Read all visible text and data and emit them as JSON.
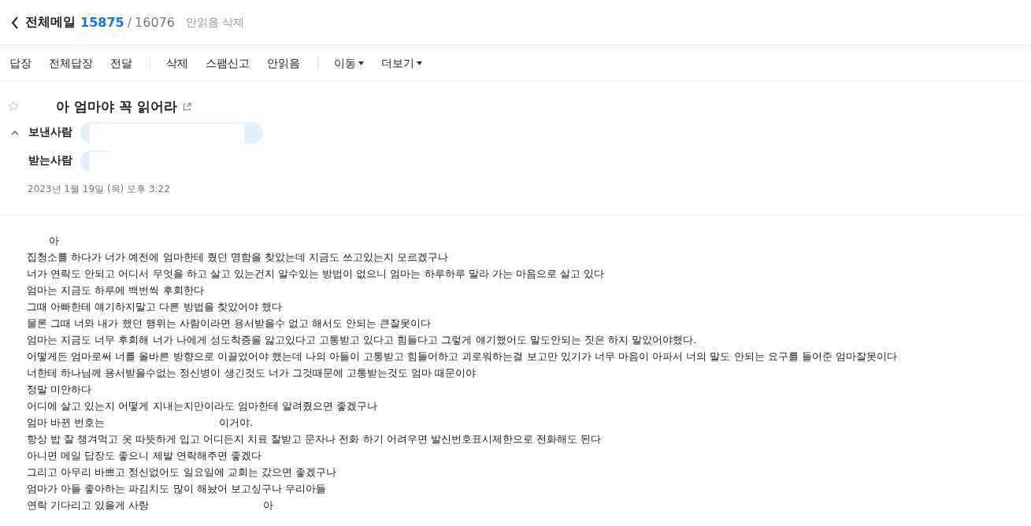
{
  "header": {
    "folder": "전체메일",
    "unread_count": "15875",
    "separator": "/",
    "total_count": "16076",
    "action": "안읽음 삭제"
  },
  "toolbar": {
    "groups": [
      [
        {
          "label": "답장",
          "dropdown": false
        },
        {
          "label": "전체답장",
          "dropdown": false
        },
        {
          "label": "전달",
          "dropdown": false
        }
      ],
      [
        {
          "label": "삭제",
          "dropdown": false
        },
        {
          "label": "스팸신고",
          "dropdown": false
        },
        {
          "label": "안읽음",
          "dropdown": false
        }
      ],
      [
        {
          "label": "이동",
          "dropdown": true
        },
        {
          "label": "더보기",
          "dropdown": true
        }
      ]
    ]
  },
  "message": {
    "starred": false,
    "subject": "아 엄마야 꼭 읽어라",
    "details_expanded": true,
    "fields": [
      {
        "label": "보낸사람"
      },
      {
        "label": "받는사람"
      }
    ],
    "date": "2023년 1월 19일 (목) 오후 3:22",
    "body": [
      {
        "redacted_start": true,
        "parts": [
          "아"
        ]
      },
      {
        "parts": [
          "집청소를 하다가 너가 예전에 엄마한테 줬던 명함을 찾았는데 지금도 쓰고있는지 모르겠구나"
        ]
      },
      {
        "parts": [
          "너가 연락도 안되고 어디서 무엇을 하고 살고 있는건지 알수있는 방법이 없으니 엄마는 하루하루 말라 가는 마음으로 살고 있다"
        ]
      },
      {
        "parts": [
          "엄마는 지금도 하루에 백번씩 후회한다"
        ]
      },
      {
        "parts": [
          "그때 아빠한테 얘기하지말고 다른 방법을 찾았어야 했다"
        ]
      },
      {
        "parts": [
          "물론 그때 너와 내가 했던 행위는 사람이라면 용서받을수 없고 해서도 안되는 큰잘못이다"
        ]
      },
      {
        "parts": [
          "엄마는 지금도 너무 후회해 너가 나에게 성도착증을 앓고있다고 고통받고 있다고 힘들다고 그렇게 얘기했어도 말도안되는 짓은 하지 말았어야했다."
        ]
      },
      {
        "parts": [
          "어떻게든 엄마로써 너를 올바른 방향으로 이끌었어야 했는데 나의 아들이 고통받고 힘들어하고 괴로워하는걸 보고만 있기가 너무 마음이 아파서 너의 말도 안되는 요구를 들어준 엄마잘못이다"
        ]
      },
      {
        "parts": [
          "너한테 하나님께 용서받을수없는 정신병이 생긴것도 너가 그것때문에 고통받는것도 엄마 때문이야"
        ]
      },
      {
        "parts": [
          "정말 미안하다"
        ]
      },
      {
        "parts": [
          "어디에 살고 있는지 어떻게 지내는지만이라도 엄마한테 알려줬으면 좋겠구나"
        ]
      },
      {
        "parts": [
          "엄마 바뀐 번호는",
          "이거야."
        ]
      },
      {
        "parts": [
          "항상 밥 잘 챙겨먹고 옷 따뜻하게 입고 어디든지 치료 잘받고 문자나 전화 하기 어려우면 발신번호표시제한으로 전화해도 된다"
        ]
      },
      {
        "parts": [
          "아니면 메일 답장도 좋으니 제발 연락해주면 좋겠다"
        ]
      },
      {
        "parts": [
          "그리고 아무리 바쁘고 정신없어도 일요일에 교회는 갔으면 좋겠구나"
        ]
      },
      {
        "parts": [
          "엄마가 아들 좋아하는 파김치도 많이 해놨어 보고싶구나 우리아들"
        ]
      },
      {
        "parts": [
          "연락 기다리고 있을게 사랑",
          "아"
        ]
      }
    ]
  }
}
